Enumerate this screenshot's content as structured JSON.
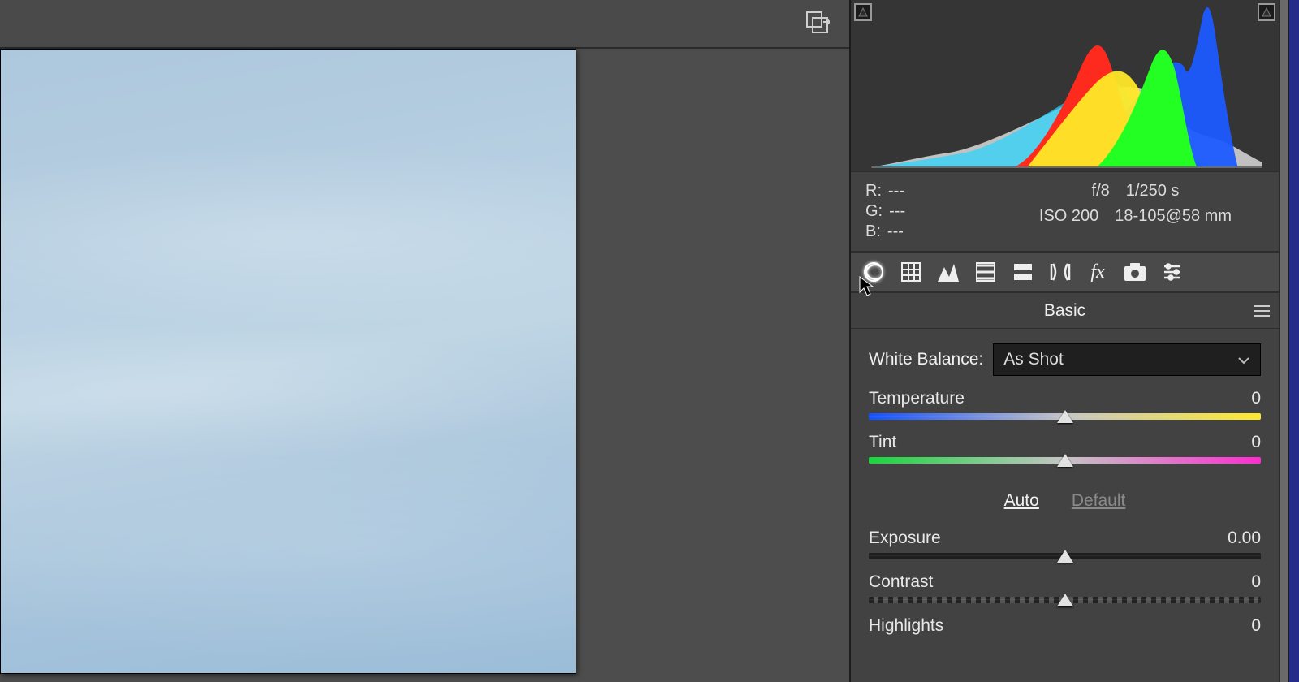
{
  "canvas": {},
  "histogram": {
    "rgb": {
      "r_label": "R:",
      "r_value": "---",
      "g_label": "G:",
      "g_value": "---",
      "b_label": "B:",
      "b_value": "---"
    },
    "exif": {
      "aperture": "f/8",
      "shutter": "1/250 s",
      "iso": "ISO 200",
      "lens": "18-105@58 mm"
    }
  },
  "tabs": {
    "basic_icon": "aperture",
    "curve_icon": "grid",
    "detail_icon": "peaks",
    "color_icon": "stack",
    "split_icon": "split",
    "lens_icon": "lens",
    "fx_label": "fx",
    "camera_icon": "camera",
    "presets_icon": "sliders"
  },
  "panel": {
    "title": "Basic",
    "white_balance": {
      "label": "White Balance:",
      "selected": "As Shot"
    },
    "temperature": {
      "label": "Temperature",
      "value": "0"
    },
    "tint": {
      "label": "Tint",
      "value": "0"
    },
    "auto_label": "Auto",
    "default_label": "Default",
    "exposure": {
      "label": "Exposure",
      "value": "0.00"
    },
    "contrast": {
      "label": "Contrast",
      "value": "0"
    },
    "highlights": {
      "label": "Highlights",
      "value": "0"
    }
  }
}
